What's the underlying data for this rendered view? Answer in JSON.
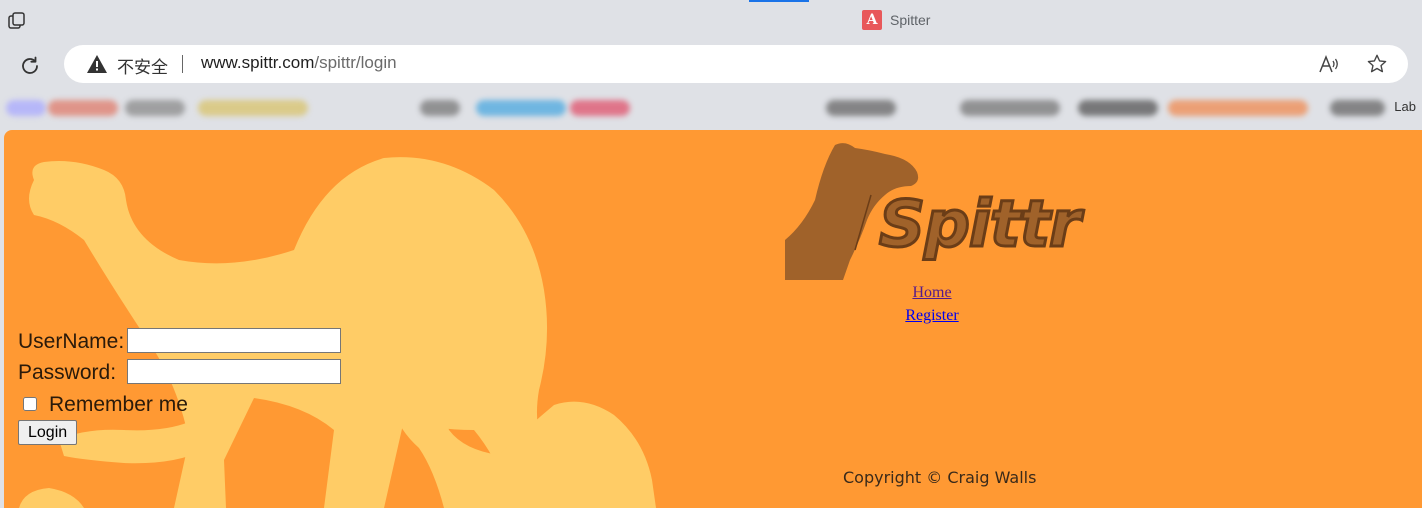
{
  "browser": {
    "tab": {
      "title": "Spitter",
      "favicon_letter": "A",
      "favicon_color": "#e8585a"
    },
    "address_bar": {
      "security_label": "不安全",
      "url_host": "www.spittr.com",
      "url_path": "/spittr/login"
    },
    "bookmarks_bar": {
      "trailing_text": "Lab"
    },
    "icons": [
      "workspaces-icon",
      "reload-icon",
      "warning-icon",
      "read-aloud-icon",
      "favorite-star-icon"
    ]
  },
  "page": {
    "colors": {
      "background": "#ff9933",
      "camel": "#ffcc66",
      "logo": "#a0622a"
    },
    "logo_text": "Spittr",
    "nav": {
      "home": "Home",
      "register": "Register"
    },
    "form": {
      "username_label": "UserName:",
      "password_label": "Password:",
      "username_value": "",
      "password_value": "",
      "remember_label": "Remember me",
      "remember_checked": false,
      "login_button": "Login"
    },
    "footer": {
      "copyright": "Copyright © Craig Walls"
    }
  }
}
